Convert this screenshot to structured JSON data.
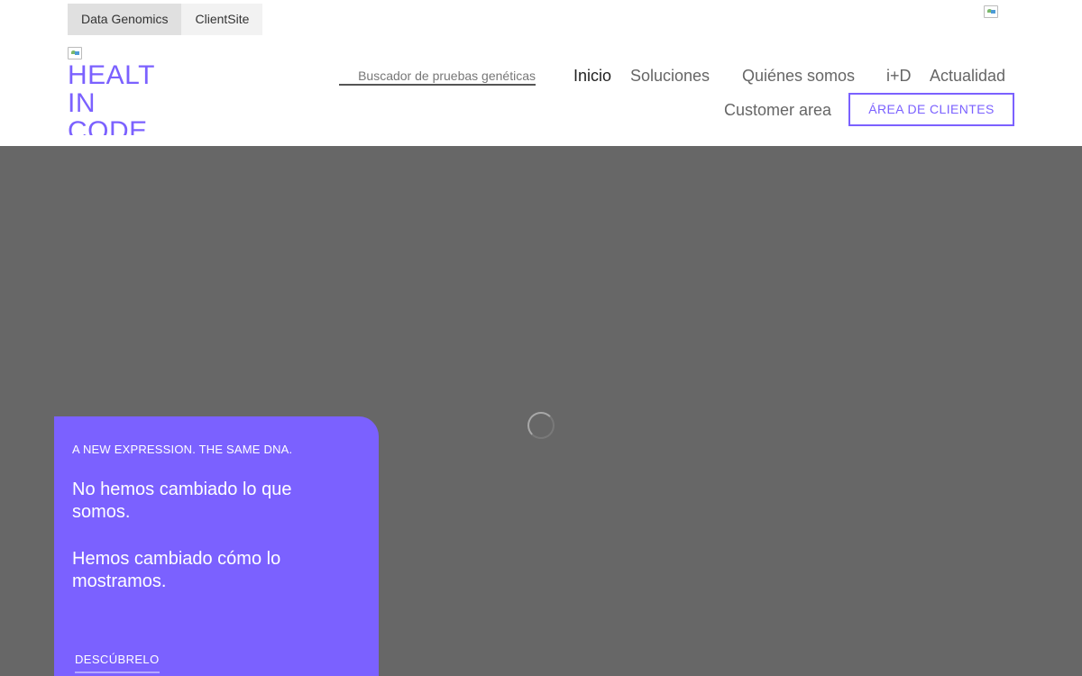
{
  "top_tabs": [
    {
      "label": "Data Genomics"
    },
    {
      "label": "ClientSite"
    }
  ],
  "logo": {
    "text": "HEALT\nIN\nCODE"
  },
  "search": {
    "placeholder": "Buscador de pruebas genéticas"
  },
  "nav": {
    "items": [
      {
        "label": "Inicio"
      },
      {
        "label": "Soluciones"
      },
      {
        "label": "Quiénes somos"
      },
      {
        "label": "i+D"
      },
      {
        "label": "Actualidad"
      },
      {
        "label": "Customer area"
      }
    ],
    "client_button": "ÁREA DE CLIENTES"
  },
  "hero": {
    "eyebrow": "A NEW EXPRESSION. THE SAME DNA.",
    "paragraph_1": "No hemos cambiado lo que somos.",
    "paragraph_2": "Hemos cambiado cómo lo mostramos.",
    "cta": "DESCÚBRELO"
  },
  "colors": {
    "accent": "#7b61ff",
    "hero_background": "#676767",
    "text_dark": "#222222",
    "text_muted": "#666666"
  },
  "icons": {
    "language_flag": "broken-image-icon",
    "logo_image": "broken-image-icon",
    "loading": "spinner-icon"
  }
}
